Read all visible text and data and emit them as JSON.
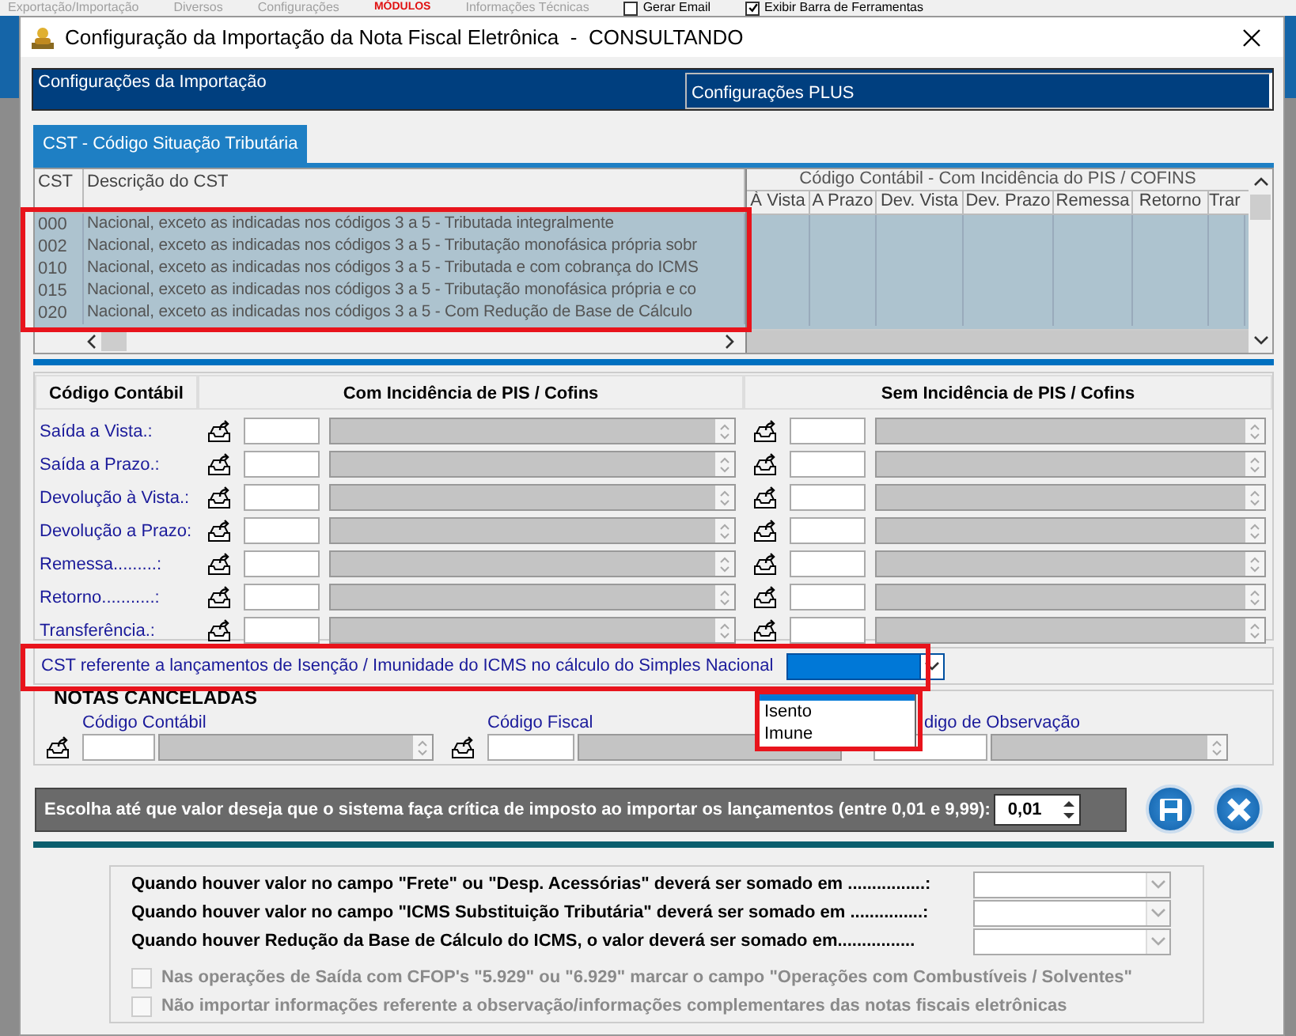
{
  "background_menu": [
    {
      "kind": "grayed",
      "label": "Exportação/Importação"
    },
    {
      "kind": "grayed",
      "label": "Diversos"
    },
    {
      "kind": "grayed",
      "label": "Configurações"
    },
    {
      "kind": "alert",
      "label": "MÓDULOS"
    },
    {
      "kind": "grayed",
      "label": "Informações Técnicas"
    },
    {
      "kind": "checkbox",
      "label": "Gerar Email",
      "checked": false
    },
    {
      "kind": "checkbox",
      "label": "Exibir Barra de Ferramentas",
      "checked": true
    }
  ],
  "window": {
    "title": "Configuração da Importação da Nota Fiscal Eletrônica  -  CONSULTANDO"
  },
  "tabs": [
    {
      "label": "Configurações da Importação",
      "selected": true
    },
    {
      "label": "Configurações PLUS",
      "selected": false
    }
  ],
  "subtabs": [
    {
      "label": "CST - Código Situação Tributária",
      "selected": true
    }
  ],
  "cst_table": {
    "highlight": true,
    "columns": [
      "CST",
      "Descrição do CST"
    ],
    "group_header": "Código Contábil - Com Incidência do PIS / COFINS",
    "group_columns": [
      "À Vista",
      "A Prazo",
      "Dev. Vista",
      "Dev. Prazo",
      "Remessa",
      "Retorno",
      "Trar"
    ],
    "rows": [
      {
        "cst": "000",
        "description": "Nacional, exceto as indicadas nos códigos 3 a 5 - Tributada integralmente"
      },
      {
        "cst": "002",
        "description": "Nacional, exceto as indicadas nos códigos 3 a 5 - Tributação monofásica própria sobr"
      },
      {
        "cst": "010",
        "description": "Nacional, exceto as indicadas nos códigos 3 a 5 - Tributada e com cobrança do ICMS"
      },
      {
        "cst": "015",
        "description": "Nacional, exceto as indicadas nos códigos 3 a 5 - Tributação monofásica própria e co"
      },
      {
        "cst": "020",
        "description": "Nacional, exceto as indicadas nos códigos 3 a 5 - Com Redução de Base de Cálculo"
      }
    ]
  },
  "accounts": {
    "columns": [
      "Código Contábil",
      "Com Incidência de PIS / Cofins",
      "Sem Incidência de PIS / Cofins"
    ],
    "rows": [
      {
        "label": "Saída a Vista.:"
      },
      {
        "label": "Saída a Prazo.:"
      },
      {
        "label": "Devolução à Vista.:"
      },
      {
        "label": "Devolução a Prazo:"
      },
      {
        "label": "Remessa.........:"
      },
      {
        "label": "Retorno...........:"
      },
      {
        "label": "Transferência.:"
      }
    ]
  },
  "simples": {
    "highlight": true,
    "label": "CST referente a lançamentos de Isenção / Imunidade do ICMS no cálculo do Simples Nacional",
    "dropdown": {
      "open": true,
      "list_highlight": true,
      "options": [
        "Isento",
        "Imune"
      ]
    }
  },
  "notas_canceladas": {
    "title": "NOTAS CANCELADAS",
    "fields": [
      {
        "label": "Código Contábil"
      },
      {
        "label": "Código Fiscal"
      },
      {
        "label": "digo de Observação"
      }
    ]
  },
  "threshold": {
    "label": "Escolha até que valor deseja que o sistema faça crítica de imposto ao importar os lançamentos (entre 0,01 e 9,99):",
    "value": "0,01"
  },
  "options": [
    {
      "kind": "combo",
      "label": "Quando houver valor no campo \"Frete\" ou \"Desp. Acessórias\" deverá ser somado em ................:"
    },
    {
      "kind": "combo",
      "label": "Quando houver valor no campo \"ICMS Substituição Tributária\" deverá ser somado em ...............:"
    },
    {
      "kind": "combo",
      "label": "Quando houver Redução da Base de Cálculo do ICMS, o valor deverá ser somado em................"
    },
    {
      "kind": "checkbox",
      "label": "Nas operações de Saída com CFOP's \"5.929\" ou \"6.929\" marcar o campo \"Operações com Combustíveis / Solventes\"",
      "checked": false,
      "disabled": true
    },
    {
      "kind": "checkbox",
      "label": "Não importar informações referente a observação/informações complementares das notas fiscais eletrônicas",
      "checked": false,
      "disabled": true
    }
  ]
}
